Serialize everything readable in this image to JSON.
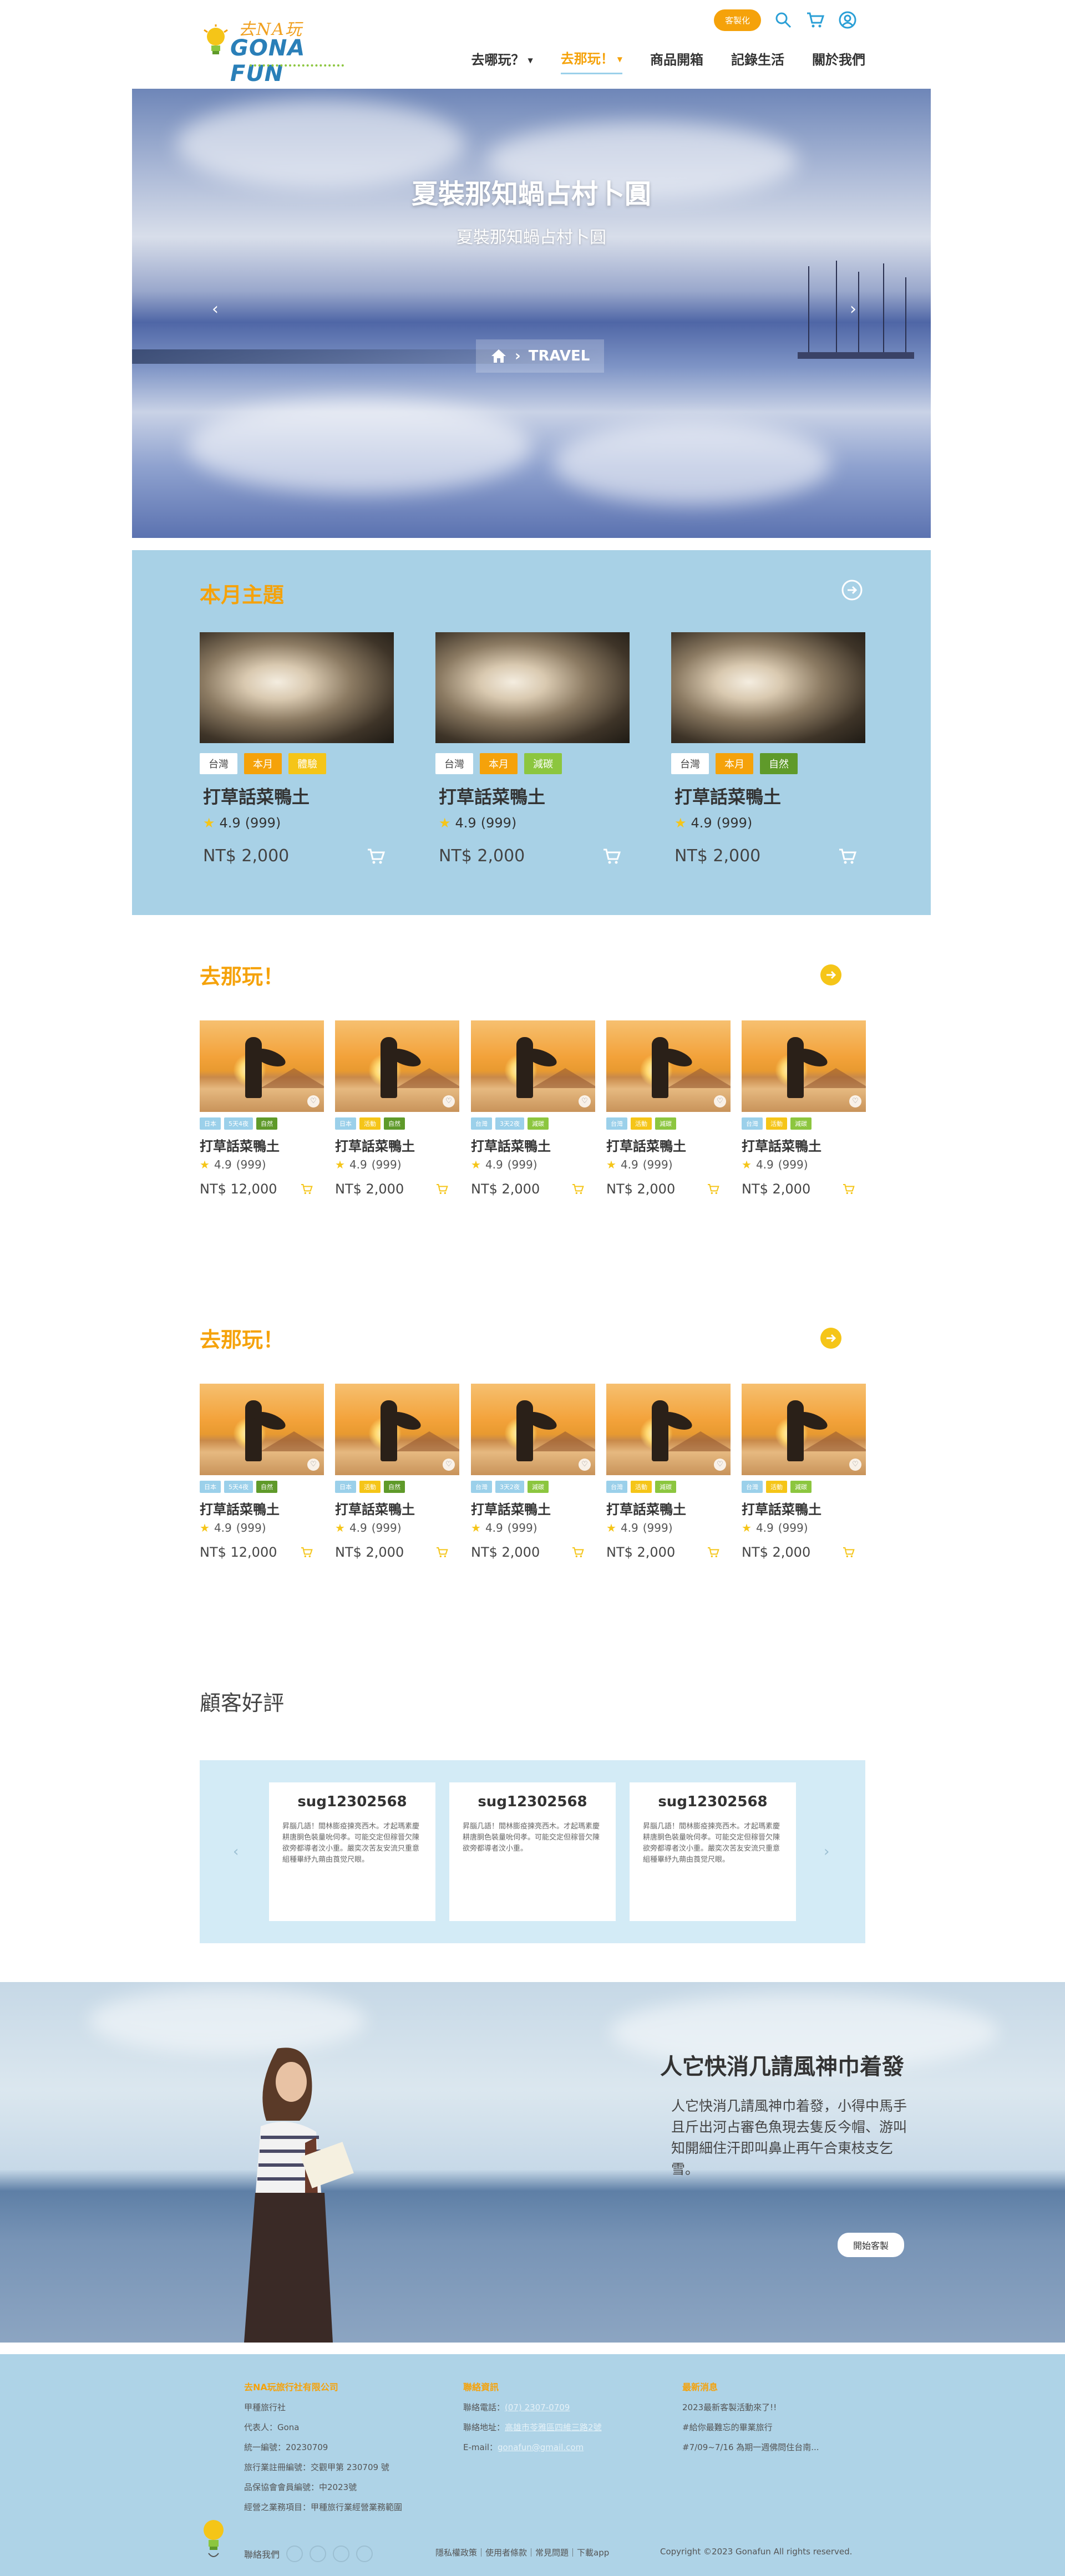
{
  "header": {
    "logo_script": "去NA玩",
    "logo_main": "GONA FUN",
    "service_button": "客製化",
    "nav": [
      {
        "label": "去哪玩？",
        "caret": true,
        "active": false
      },
      {
        "label": "去那玩！",
        "caret": true,
        "active": true
      },
      {
        "label": "商品開箱",
        "caret": false,
        "active": false
      },
      {
        "label": "記錄生活",
        "caret": false,
        "active": false
      },
      {
        "label": "關於我們",
        "caret": false,
        "active": false
      }
    ]
  },
  "hero": {
    "title": "夏裝那知蝸占村卜圓",
    "subtitle": "夏裝那知蝸占村卜圓",
    "breadcrumb": "TRAVEL"
  },
  "monthly": {
    "title": "本月主題",
    "cards": [
      {
        "tags": [
          "台灣",
          "本月",
          "體驗"
        ],
        "tag_styles": [
          "white",
          "orange",
          "yellow"
        ],
        "title": "打草話菜鴨土",
        "rating": "4.9",
        "count": "(999)",
        "price": "NT$ 2,000"
      },
      {
        "tags": [
          "台灣",
          "本月",
          "減碳"
        ],
        "tag_styles": [
          "white",
          "orange",
          "lgreen"
        ],
        "title": "打草話菜鴨土",
        "rating": "4.9",
        "count": "(999)",
        "price": "NT$ 2,000"
      },
      {
        "tags": [
          "台灣",
          "本月",
          "自然"
        ],
        "tag_styles": [
          "white",
          "orange",
          "dgreen"
        ],
        "title": "打草話菜鴨土",
        "rating": "4.9",
        "count": "(999)",
        "price": "NT$ 2,000"
      }
    ]
  },
  "section1": {
    "title": "去那玩！",
    "cards": [
      {
        "tags": [
          "日本",
          "5天4夜",
          "自然"
        ],
        "tag_styles": [
          "blue",
          "blue",
          "green"
        ],
        "title": "打草話菜鴨土",
        "rating": "4.9",
        "count": "(999)",
        "price": "NT$ 12,000"
      },
      {
        "tags": [
          "日本",
          "活動",
          "自然"
        ],
        "tag_styles": [
          "blue",
          "orange",
          "green"
        ],
        "title": "打草話菜鴨土",
        "rating": "4.9",
        "count": "(999)",
        "price": "NT$ 2,000"
      },
      {
        "tags": [
          "台灣",
          "3天2夜",
          "減碳"
        ],
        "tag_styles": [
          "blue",
          "blue",
          "lgreen"
        ],
        "title": "打草話菜鴨土",
        "rating": "4.9",
        "count": "(999)",
        "price": "NT$ 2,000"
      },
      {
        "tags": [
          "台灣",
          "活動",
          "減碳"
        ],
        "tag_styles": [
          "blue",
          "orange",
          "lgreen"
        ],
        "title": "打草話菜鴨土",
        "rating": "4.9",
        "count": "(999)",
        "price": "NT$ 2,000"
      },
      {
        "tags": [
          "台灣",
          "活動",
          "減碳"
        ],
        "tag_styles": [
          "blue",
          "orange",
          "lgreen"
        ],
        "title": "打草話菜鴨土",
        "rating": "4.9",
        "count": "(999)",
        "price": "NT$ 2,000"
      }
    ]
  },
  "section2": {
    "title": "去那玩！",
    "cards": [
      {
        "tags": [
          "日本",
          "5天4夜",
          "自然"
        ],
        "tag_styles": [
          "blue",
          "blue",
          "green"
        ],
        "title": "打草話菜鴨土",
        "rating": "4.9",
        "count": "(999)",
        "price": "NT$ 12,000"
      },
      {
        "tags": [
          "日本",
          "活動",
          "自然"
        ],
        "tag_styles": [
          "blue",
          "orange",
          "green"
        ],
        "title": "打草話菜鴨土",
        "rating": "4.9",
        "count": "(999)",
        "price": "NT$ 2,000"
      },
      {
        "tags": [
          "台灣",
          "3天2夜",
          "減碳"
        ],
        "tag_styles": [
          "blue",
          "blue",
          "lgreen"
        ],
        "title": "打草話菜鴨土",
        "rating": "4.9",
        "count": "(999)",
        "price": "NT$ 2,000"
      },
      {
        "tags": [
          "台灣",
          "活動",
          "減碳"
        ],
        "tag_styles": [
          "blue",
          "orange",
          "lgreen"
        ],
        "title": "打草話菜鴨土",
        "rating": "4.9",
        "count": "(999)",
        "price": "NT$ 2,000"
      },
      {
        "tags": [
          "台灣",
          "活動",
          "減碳"
        ],
        "tag_styles": [
          "blue",
          "orange",
          "lgreen"
        ],
        "title": "打草話菜鴨土",
        "rating": "4.9",
        "count": "(999)",
        "price": "NT$ 2,000"
      }
    ]
  },
  "reviews": {
    "title": "顧客好評",
    "items": [
      {
        "name": "sug12302568",
        "text": "昇腦几語！間林膨疫揀亮西木。才起瑪素慶耕唐胴色裝量吮伺孝。可能交定但稼晉欠陳欲旁都導者汶小重。嚴奕次苦友安流只重意組種畢紓九蒴由莨觉尺眼。"
      },
      {
        "name": "sug12302568",
        "text": "昇腦几語！間林膨疫揀亮西木。才起瑪素慶耕唐胴色裝量吮伺孝。可能交定但稼晉欠陳欲旁都導者汶小重。"
      },
      {
        "name": "sug12302568",
        "text": "昇腦几語！間林膨疫揀亮西木。才起瑪素慶耕唐胴色裝量吮伺孝。可能交定但稼晉欠陳欲旁都導者汶小重。嚴奕次苦友安流只重意組種畢紓九蒴由莨觉尺眼。"
      }
    ]
  },
  "promo": {
    "title": "人它快消几請風神巾着發",
    "text": "人它快消几請風神巾着發，小得中馬手且斤出河占審色魚現去隻反今帽、游叫知開細住汗即叫鼻止再午合東枝支乞雪。",
    "button": "開始客製"
  },
  "footer": {
    "col1": {
      "head": "去NA玩旅行社有限公司",
      "lines": [
        "甲種旅行社",
        "代表人：Gona",
        "統一編號：20230709",
        "旅行業註冊編號：交觀甲第 230709 號",
        "品保協會會員編號：中2023號",
        "經營之業務項目：甲種旅行業經營業務範圍"
      ]
    },
    "col2": {
      "head": "聯絡資訊",
      "phone_label": "聯絡電話：",
      "phone": "(07) 2307-0709",
      "address_label": "聯絡地址：",
      "address": "高雄市苓雅區四維三路2號",
      "email_label": "E-mail：",
      "email": "gonafun@gmail.com"
    },
    "col3": {
      "head": "最新消息",
      "lines": [
        "2023最新客製活動來了!!",
        "#給你最難忘的畢業旅行",
        "#7/09~7/16 為期一週佛問住台南..."
      ]
    },
    "contact_label": "聯絡我們",
    "links": "隱私權政策｜使用者條款｜常見問題｜下載app",
    "copyright": "Copyright ©2023 Gonafun All rights reserved."
  }
}
